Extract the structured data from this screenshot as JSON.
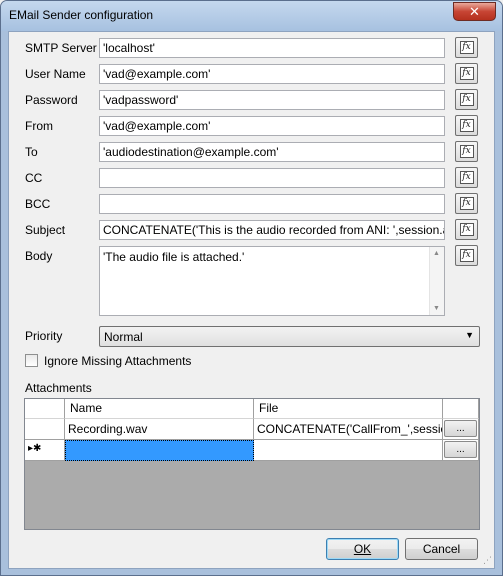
{
  "window": {
    "title": "EMail Sender configuration",
    "close_glyph": "✕"
  },
  "fields": {
    "smtp_server": {
      "label": "SMTP Server",
      "value": "'localhost'"
    },
    "user_name": {
      "label": "User Name",
      "value": "'vad@example.com'"
    },
    "password": {
      "label": "Password",
      "value": "'vadpassword'"
    },
    "from": {
      "label": "From",
      "value": "'vad@example.com'"
    },
    "to": {
      "label": "To",
      "value": "'audiodestination@example.com'"
    },
    "cc": {
      "label": "CC",
      "value": ""
    },
    "bcc": {
      "label": "BCC",
      "value": ""
    },
    "subject": {
      "label": "Subject",
      "value": "CONCATENATE('This is the audio recorded from ANI: ',session.ani)"
    },
    "body": {
      "label": "Body",
      "value": "'The audio file is attached.'"
    }
  },
  "fx_label": "fx",
  "priority": {
    "label": "Priority",
    "value": "Normal"
  },
  "ignore_missing": {
    "label": "Ignore Missing Attachments",
    "checked": false
  },
  "attachments": {
    "label": "Attachments",
    "columns": [
      "Name",
      "File"
    ],
    "rows": [
      {
        "name": "Recording.wav",
        "file": "CONCATENATE('CallFrom_',session..."
      }
    ],
    "new_row_marker": "▸✱",
    "ellipsis": "..."
  },
  "buttons": {
    "ok": "OK",
    "cancel": "Cancel"
  }
}
